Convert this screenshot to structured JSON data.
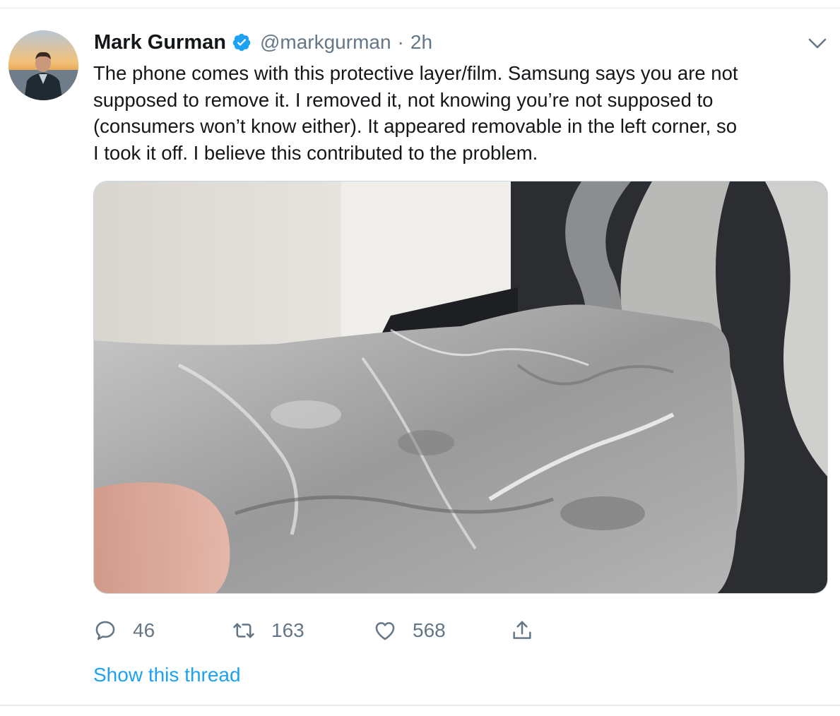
{
  "tweet": {
    "author_name": "Mark Gurman",
    "handle": "@markgurman",
    "separator": "·",
    "time": "2h",
    "verified": true,
    "text_lines": [
      "The phone comes with this protective layer/film. Samsung says you are not",
      "supposed to remove it. I removed it, not knowing you’re not supposed to",
      "(consumers won’t know either). It appeared removable in the left corner, so",
      "I took it off. I believe this contributed to the problem."
    ],
    "media_icon": "photo-of-crumpled-protective-film",
    "actions": {
      "reply": {
        "icon": "reply-icon",
        "count": "46"
      },
      "retweet": {
        "icon": "retweet-icon",
        "count": "163"
      },
      "like": {
        "icon": "heart-icon",
        "count": "568"
      },
      "share": {
        "icon": "share-icon"
      }
    },
    "show_thread_label": "Show this thread"
  },
  "colors": {
    "accent": "#1da1f2",
    "secondary_text": "#657786",
    "primary_text": "#14171a",
    "divider": "#e6ecf0"
  }
}
